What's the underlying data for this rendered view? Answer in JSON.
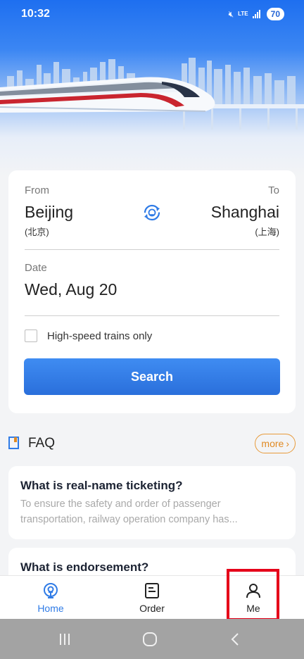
{
  "status_bar": {
    "time": "10:32",
    "network": "LTE",
    "battery": "70"
  },
  "search": {
    "from_label": "From",
    "to_label": "To",
    "from_city": "Beijing",
    "from_city_cn": "(北京)",
    "to_city": "Shanghai",
    "to_city_cn": "(上海)",
    "date_label": "Date",
    "date_value": "Wed, Aug 20",
    "high_speed_label": "High-speed trains only",
    "high_speed_checked": false,
    "search_button": "Search"
  },
  "faq": {
    "title": "FAQ",
    "more_label": "more",
    "items": [
      {
        "question": "What is real-name ticketing?",
        "answer": "To ensure the safety and order of passenger transportation, railway operation company has..."
      },
      {
        "question": "What is endorsement?",
        "answer": ""
      }
    ]
  },
  "tabbar": {
    "tabs": [
      {
        "label": "Home",
        "icon": "home-train-icon",
        "active": true
      },
      {
        "label": "Order",
        "icon": "order-document-icon",
        "active": false
      },
      {
        "label": "Me",
        "icon": "person-icon",
        "active": false
      }
    ]
  },
  "colors": {
    "accent": "#2f7be6",
    "faq_more": "#e08a24",
    "highlight": "#e5001a"
  }
}
